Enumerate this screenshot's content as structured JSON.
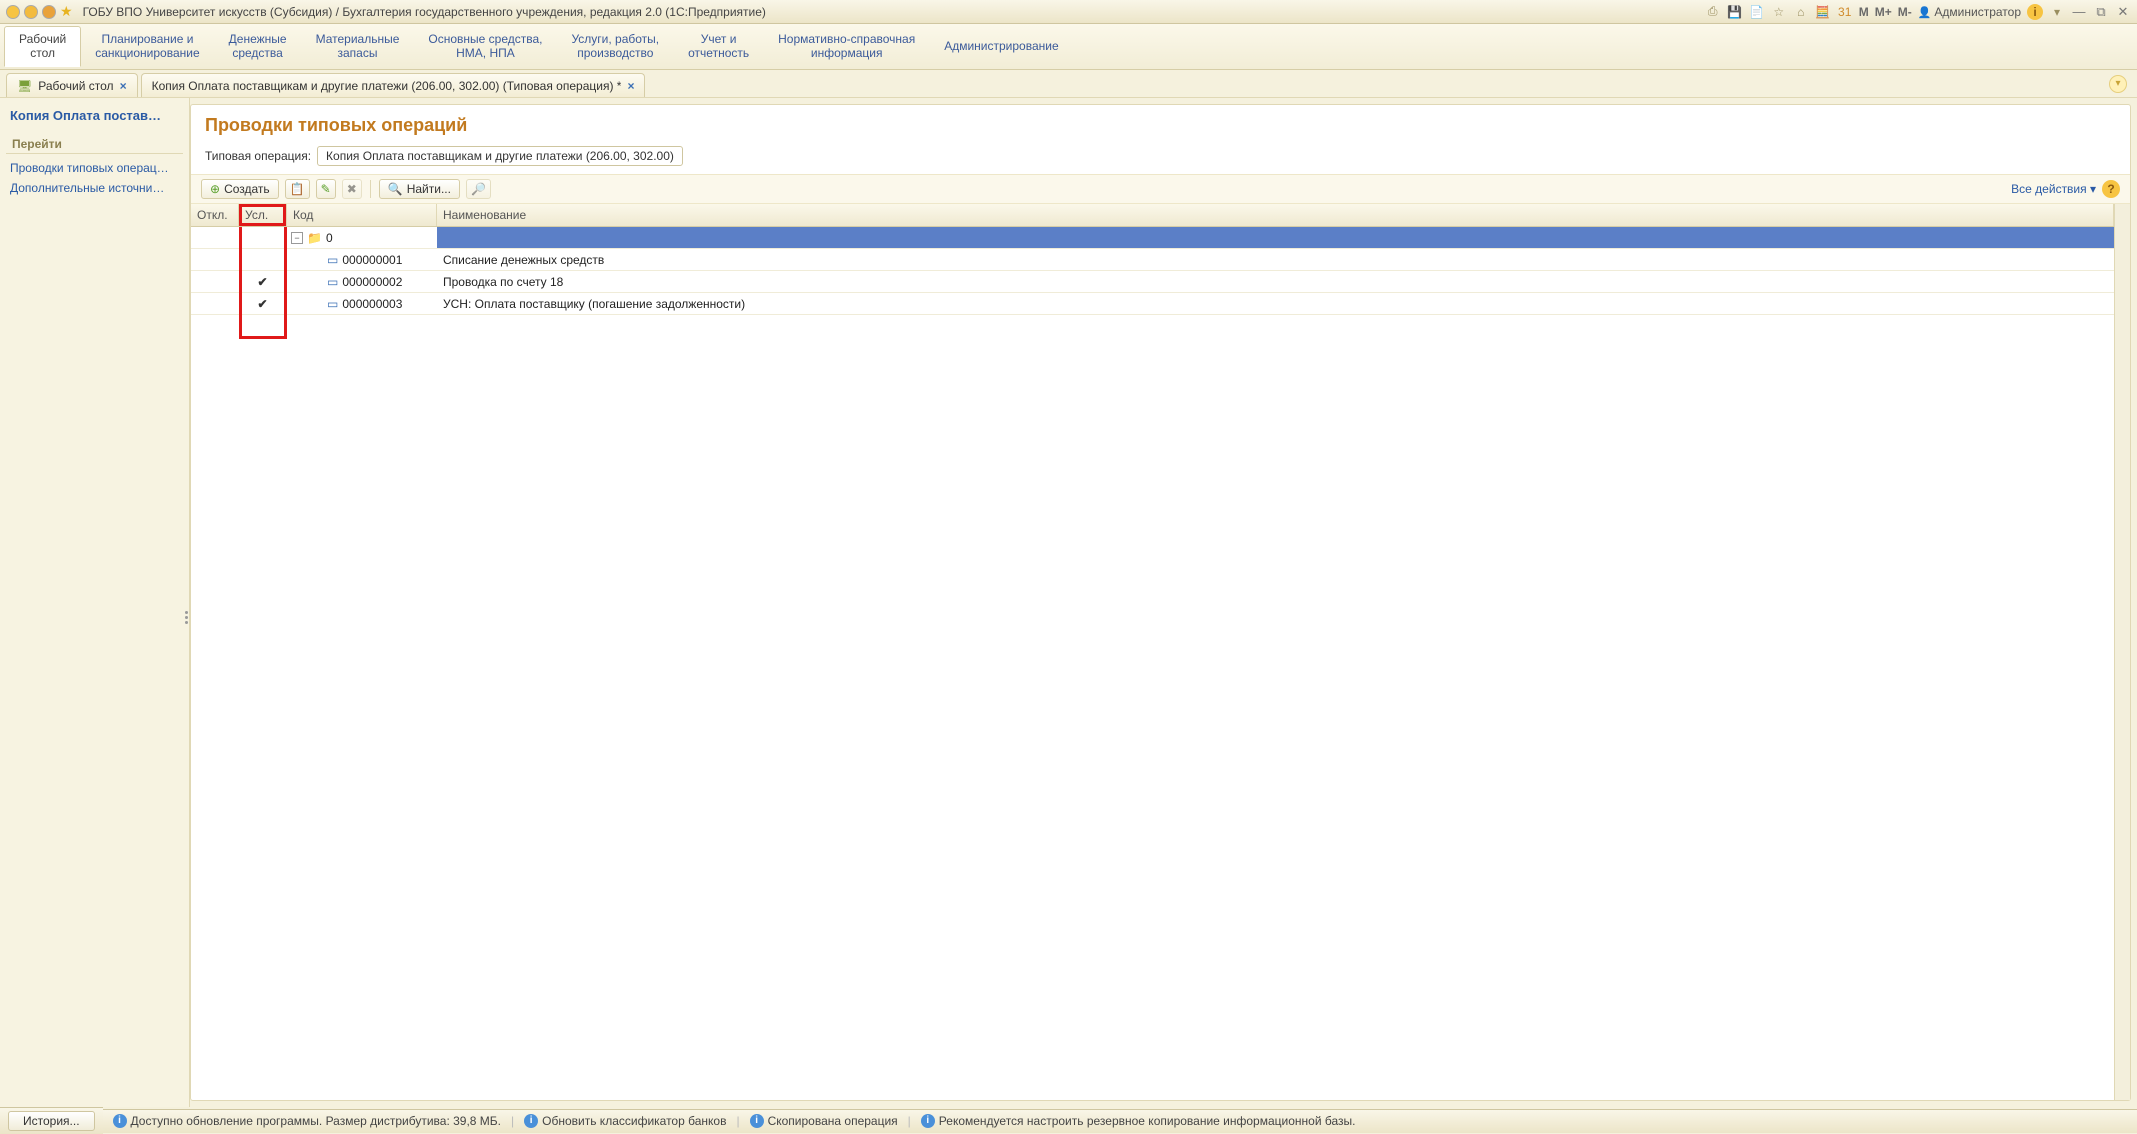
{
  "titlebar": {
    "title": "ГОБУ ВПО Университет искусств (Субсидия) / Бухгалтерия государственного учреждения, редакция 2.0  (1С:Предприятие)",
    "user": "Администратор",
    "m": "M",
    "mplus": "M+",
    "mminus": "M-"
  },
  "sections": [
    {
      "l1": "Рабочий",
      "l2": "стол",
      "active": true
    },
    {
      "l1": "Планирование и",
      "l2": "санкционирование"
    },
    {
      "l1": "Денежные",
      "l2": "средства"
    },
    {
      "l1": "Материальные",
      "l2": "запасы"
    },
    {
      "l1": "Основные средства,",
      "l2": "НМА, НПА"
    },
    {
      "l1": "Услуги, работы,",
      "l2": "производство"
    },
    {
      "l1": "Учет и",
      "l2": "отчетность"
    },
    {
      "l1": "Нормативно-справочная",
      "l2": "информация"
    },
    {
      "l1": "Администрирование",
      "l2": ""
    }
  ],
  "tabs": {
    "desktop": "Рабочий стол",
    "doc": "Копия Оплата поставщикам и другие платежи (206.00, 302.00) (Типовая операция) *"
  },
  "sidebar": {
    "title": "Копия Оплата постав…",
    "group": "Перейти",
    "links": [
      "Проводки типовых операц…",
      "Дополнительные источни…"
    ]
  },
  "page": {
    "heading": "Проводки типовых операций",
    "field_label": "Типовая операция:",
    "field_value": "Копия Оплата поставщикам и другие платежи (206.00, 302.00)"
  },
  "toolbar": {
    "create": "Создать",
    "find": "Найти...",
    "all_actions": "Все действия"
  },
  "grid": {
    "headers": {
      "otk": "Откл.",
      "usl": "Усл.",
      "kod": "Код",
      "name": "Наименование"
    },
    "root_code": "0",
    "rows": [
      {
        "usl": "",
        "code": "000000001",
        "name": "Списание денежных средств"
      },
      {
        "usl": "✔",
        "code": "000000002",
        "name": "Проводка по счету 18"
      },
      {
        "usl": "✔",
        "code": "000000003",
        "name": "УСН: Оплата поставщику (погашение задолженности)"
      }
    ]
  },
  "status": {
    "history": "История...",
    "s1": "Доступно обновление программы. Размер дистрибутива: 39,8 МБ.",
    "s2": "Обновить классификатор банков",
    "s3": "Скопирована операция",
    "s4": "Рекомендуется настроить резервное копирование информационной базы."
  }
}
